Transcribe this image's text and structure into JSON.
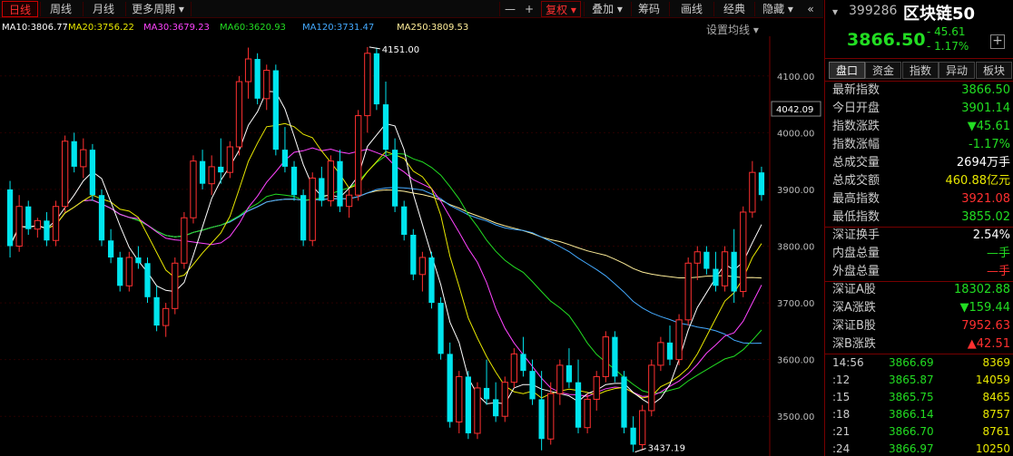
{
  "toolbar": {
    "tabs": [
      "日线",
      "周线",
      "月线",
      "更多周期 ▾"
    ],
    "right_buttons": [
      "—",
      "+",
      "复权 ▾",
      "叠加 ▾",
      "筹码",
      "画线",
      "经典",
      "隐藏 ▾",
      "«"
    ]
  },
  "ma_legend": {
    "ma10": "MA10:3806.77",
    "ma20": "MA20:3756.22",
    "ma30": "MA30:3679.23",
    "ma60": "MA60:3620.93",
    "ma120": "MA120:3731.47",
    "ma250": "MA250:3809.53",
    "settings": "设置均线 ▾"
  },
  "colors": {
    "up": "#ff3030",
    "down": "#00e5ee",
    "ma10": "#ffffff",
    "ma20": "#e8e800",
    "ma30": "#ff44ff",
    "ma60": "#22dd22",
    "ma120": "#44aaff",
    "ma250": "#ffee99"
  },
  "chart": {
    "y_ticks": [
      "4100.00",
      "4000.00",
      "3900.00",
      "3800.00",
      "3700.00",
      "3600.00",
      "3500.00"
    ],
    "current_price_tag": "4042.09",
    "high_annotation": "4151.00",
    "low_annotation": "3437.19"
  },
  "panel": {
    "code": "399286",
    "name": "区块链50",
    "price": "3866.50",
    "change": "- 45.61",
    "change_pct": "- 1.17%",
    "add_button": "+",
    "tabs": [
      "盘口",
      "资金",
      "指数",
      "异动",
      "板块"
    ],
    "stats": [
      {
        "label": "最新指数",
        "value": "3866.50",
        "color": "green"
      },
      {
        "label": "今日开盘",
        "value": "3901.14",
        "color": "green"
      },
      {
        "label": "指数涨跌",
        "value": "▼45.61",
        "color": "green"
      },
      {
        "label": "指数涨幅",
        "value": "-1.17%",
        "color": "green"
      },
      {
        "label": "总成交量",
        "value": "2694万手",
        "color": "white"
      },
      {
        "label": "总成交额",
        "value": "460.88亿元",
        "color": "yellow"
      },
      {
        "label": "最高指数",
        "value": "3921.08",
        "color": "red"
      },
      {
        "label": "最低指数",
        "value": "3855.02",
        "color": "green"
      }
    ],
    "stats2": [
      {
        "label": "深证换手",
        "value": "2.54%",
        "color": "white"
      },
      {
        "label": "内盘总量",
        "value": "—手",
        "color": "green"
      },
      {
        "label": "外盘总量",
        "value": "—手",
        "color": "red"
      }
    ],
    "stats3": [
      {
        "label": "深证A股",
        "value": "18302.88",
        "color": "green"
      },
      {
        "label": "深A涨跌",
        "value": "▼159.44",
        "color": "green"
      },
      {
        "label": "深证B股",
        "value": "7952.63",
        "color": "red"
      },
      {
        "label": "深B涨跌",
        "value": "▲42.51",
        "color": "red"
      }
    ],
    "ticks": [
      {
        "time": "14:56",
        "price": "3866.69",
        "vol": "8369"
      },
      {
        "time": ":12",
        "price": "3865.87",
        "vol": "14059"
      },
      {
        "time": ":15",
        "price": "3865.75",
        "vol": "8465"
      },
      {
        "time": ":18",
        "price": "3866.14",
        "vol": "8757"
      },
      {
        "time": ":21",
        "price": "3866.70",
        "vol": "8761"
      },
      {
        "time": ":24",
        "price": "3866.97",
        "vol": "10250"
      }
    ]
  },
  "chart_data": {
    "type": "candlestick",
    "ylim": [
      3430,
      4170
    ],
    "ma_legend": [
      "MA10",
      "MA20",
      "MA30",
      "MA60",
      "MA120",
      "MA250"
    ],
    "candles": [
      [
        3900,
        3915,
        3780,
        3800
      ],
      [
        3800,
        3890,
        3790,
        3870
      ],
      [
        3870,
        3880,
        3820,
        3830
      ],
      [
        3830,
        3850,
        3815,
        3845
      ],
      [
        3845,
        3860,
        3800,
        3810
      ],
      [
        3810,
        3880,
        3800,
        3870
      ],
      [
        3870,
        3995,
        3860,
        3985
      ],
      [
        3985,
        4000,
        3930,
        3940
      ],
      [
        3940,
        3990,
        3920,
        3970
      ],
      [
        3970,
        3980,
        3880,
        3890
      ],
      [
        3890,
        3900,
        3800,
        3810
      ],
      [
        3810,
        3830,
        3770,
        3780
      ],
      [
        3780,
        3790,
        3720,
        3730
      ],
      [
        3730,
        3790,
        3720,
        3780
      ],
      [
        3780,
        3800,
        3760,
        3770
      ],
      [
        3770,
        3780,
        3700,
        3710
      ],
      [
        3710,
        3730,
        3650,
        3660
      ],
      [
        3660,
        3700,
        3640,
        3690
      ],
      [
        3690,
        3780,
        3680,
        3770
      ],
      [
        3770,
        3860,
        3760,
        3850
      ],
      [
        3850,
        3960,
        3840,
        3950
      ],
      [
        3950,
        3970,
        3900,
        3910
      ],
      [
        3910,
        3960,
        3890,
        3940
      ],
      [
        3940,
        3990,
        3910,
        3930
      ],
      [
        3930,
        3985,
        3920,
        3975
      ],
      [
        3975,
        4100,
        3960,
        4090
      ],
      [
        4090,
        4150,
        4060,
        4130
      ],
      [
        4130,
        4140,
        4050,
        4060
      ],
      [
        4060,
        4120,
        4040,
        4110
      ],
      [
        4110,
        4120,
        3960,
        3970
      ],
      [
        3970,
        4010,
        3930,
        3940
      ],
      [
        3940,
        3950,
        3880,
        3890
      ],
      [
        3890,
        3900,
        3800,
        3810
      ],
      [
        3810,
        3930,
        3800,
        3920
      ],
      [
        3920,
        3940,
        3870,
        3880
      ],
      [
        3880,
        3960,
        3870,
        3950
      ],
      [
        3950,
        3970,
        3860,
        3870
      ],
      [
        3870,
        3900,
        3850,
        3890
      ],
      [
        3890,
        4040,
        3880,
        4030
      ],
      [
        4030,
        4151,
        4000,
        4140
      ],
      [
        4140,
        4150,
        4040,
        4050
      ],
      [
        4050,
        4090,
        3960,
        3970
      ],
      [
        3970,
        3990,
        3860,
        3870
      ],
      [
        3870,
        3880,
        3810,
        3820
      ],
      [
        3820,
        3830,
        3740,
        3750
      ],
      [
        3750,
        3790,
        3720,
        3780
      ],
      [
        3780,
        3790,
        3690,
        3700
      ],
      [
        3700,
        3710,
        3600,
        3610
      ],
      [
        3610,
        3630,
        3480,
        3490
      ],
      [
        3490,
        3580,
        3470,
        3570
      ],
      [
        3570,
        3580,
        3460,
        3470
      ],
      [
        3470,
        3560,
        3460,
        3550
      ],
      [
        3550,
        3600,
        3520,
        3530
      ],
      [
        3530,
        3560,
        3490,
        3500
      ],
      [
        3500,
        3570,
        3490,
        3560
      ],
      [
        3560,
        3620,
        3550,
        3610
      ],
      [
        3610,
        3640,
        3570,
        3580
      ],
      [
        3580,
        3600,
        3520,
        3530
      ],
      [
        3530,
        3580,
        3440,
        3460
      ],
      [
        3460,
        3560,
        3450,
        3540
      ],
      [
        3540,
        3600,
        3520,
        3590
      ],
      [
        3590,
        3620,
        3550,
        3560
      ],
      [
        3560,
        3600,
        3470,
        3480
      ],
      [
        3480,
        3540,
        3470,
        3530
      ],
      [
        3530,
        3580,
        3510,
        3570
      ],
      [
        3570,
        3650,
        3560,
        3640
      ],
      [
        3640,
        3650,
        3560,
        3570
      ],
      [
        3570,
        3580,
        3470,
        3480
      ],
      [
        3480,
        3500,
        3437,
        3450
      ],
      [
        3450,
        3520,
        3440,
        3510
      ],
      [
        3510,
        3600,
        3500,
        3590
      ],
      [
        3590,
        3640,
        3580,
        3630
      ],
      [
        3630,
        3660,
        3590,
        3600
      ],
      [
        3600,
        3680,
        3590,
        3670
      ],
      [
        3670,
        3780,
        3660,
        3770
      ],
      [
        3770,
        3800,
        3740,
        3790
      ],
      [
        3790,
        3800,
        3750,
        3760
      ],
      [
        3760,
        3790,
        3720,
        3730
      ],
      [
        3730,
        3800,
        3720,
        3790
      ],
      [
        3790,
        3830,
        3700,
        3720
      ],
      [
        3720,
        3870,
        3710,
        3860
      ],
      [
        3860,
        3950,
        3850,
        3930
      ],
      [
        3930,
        3940,
        3880,
        3890
      ]
    ]
  }
}
